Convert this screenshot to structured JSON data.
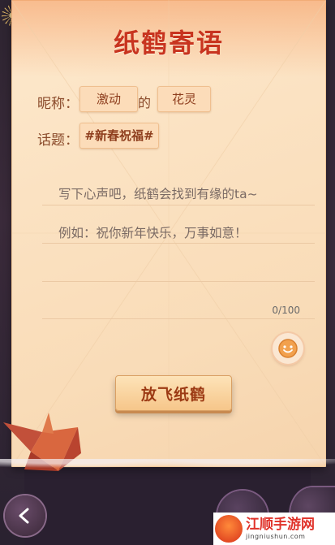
{
  "header": {
    "title": "纸鹤寄语"
  },
  "nickname": {
    "label": "昵称：",
    "first_value": "激动",
    "connector": "的",
    "second_value": "花灵"
  },
  "topic": {
    "label": "话题：",
    "value": "#新春祝福#"
  },
  "message": {
    "placeholder_line1": "写下心声吧，纸鹤会找到有缘的ta~",
    "placeholder_line2": "例如：祝你新年快乐，万事如意！",
    "counter": "0/100"
  },
  "actions": {
    "send_label": "放飞纸鹤"
  },
  "icons": {
    "emoji": "smiley-icon",
    "back": "back-arrow-icon",
    "crane": "paper-crane-icon"
  },
  "watermark": {
    "title": "江顺手游网",
    "subtitle": "jingniushun.com"
  },
  "colors": {
    "title": "#c8341f",
    "paper": "#fbe2c2",
    "accent_button": "#f6c68a"
  }
}
